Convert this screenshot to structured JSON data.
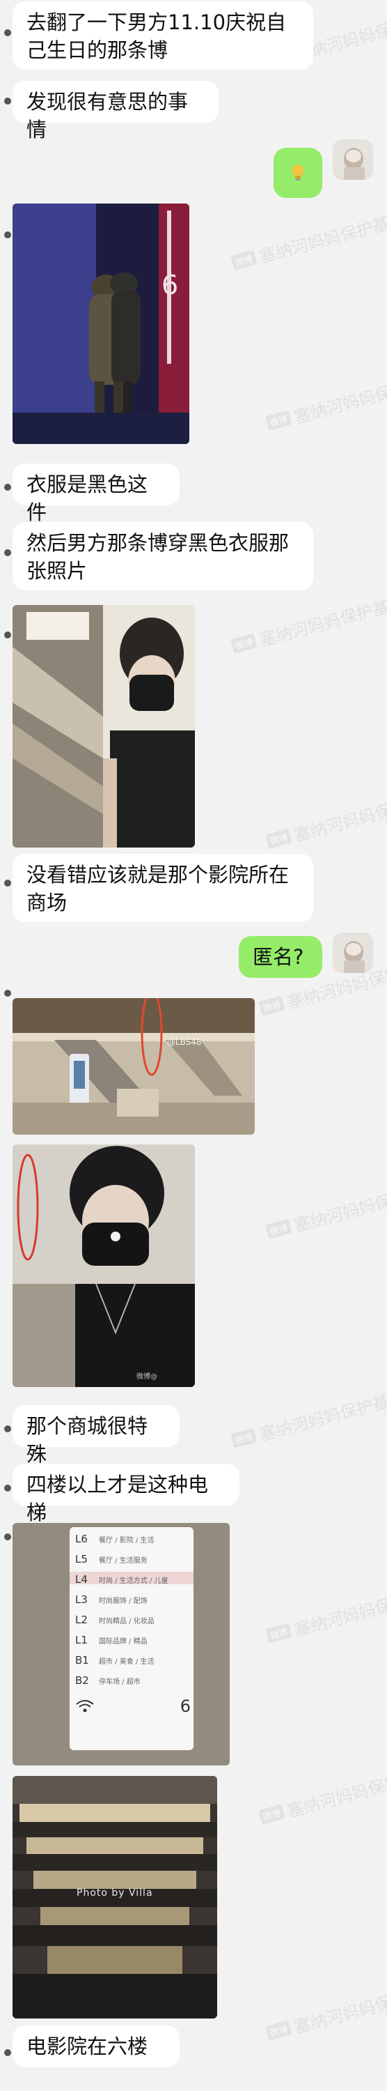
{
  "watermark": {
    "badge": "微博",
    "text": "塞纳河妈妈保护基"
  },
  "messages": {
    "m1": "去翻了一下男方11.10庆祝自己生日的那条博",
    "m1_line1": "去翻了一下男方11.10庆祝自",
    "m1_line2": "己生日的那条博",
    "m2": "发现很有意思的事情",
    "m4": "衣服是黑色这件",
    "m5_line1": "然后男方那条博穿黑色衣服那",
    "m5_line2": "张照片",
    "m7_line1": "没看错应该就是那个影院所在",
    "m7_line2": "商场",
    "m8_right": "匿名?",
    "m11": "那个商城很特殊",
    "m12": "四楼以上才是这种电梯",
    "m15": "电影院在六楼"
  },
  "photo_labels": {
    "lbs": "@LBS48",
    "photo_by": "Photo by Villa",
    "weibo_small": "微博@",
    "floor_number": "6"
  },
  "directory_floors": [
    "L6",
    "L5",
    "L4",
    "L3",
    "L2",
    "L1",
    "B1",
    "B2"
  ],
  "directory_texts": [
    "餐厅 / 影院 / 生活",
    "餐厅 / 生活服务",
    "时尚 / 生活方式 / 儿童",
    "时尚服饰 / 配饰",
    "时尚精品 / 化妆品",
    "国际品牌 / 精品",
    "超市 / 美食 / 生活",
    "停车场 / 超市"
  ],
  "colors": {
    "background": "#f2f2f2",
    "bubble_left": "#ffffff",
    "bubble_right": "#95ec69"
  }
}
